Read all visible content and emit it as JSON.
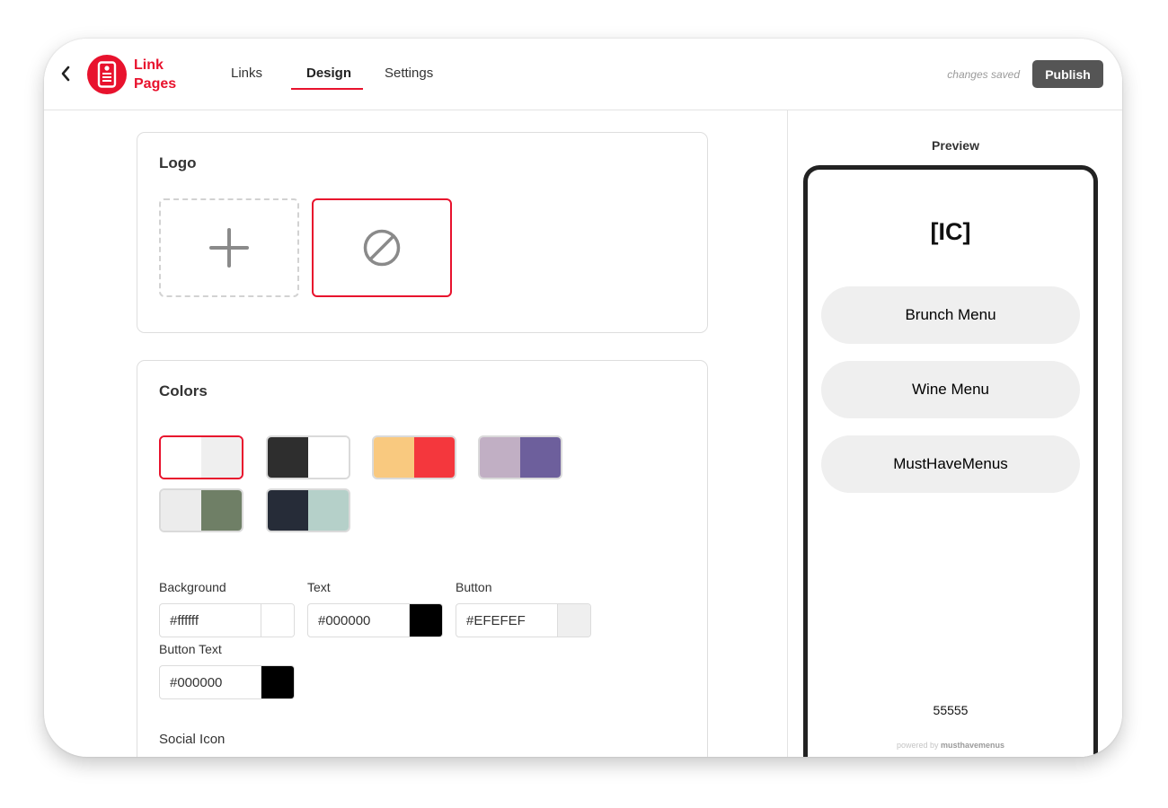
{
  "header": {
    "brand_line1": "Link",
    "brand_line2": "Pages",
    "tabs": [
      {
        "label": "Links"
      },
      {
        "label": "Design"
      },
      {
        "label": "Settings"
      }
    ],
    "active_tab": "Design",
    "status": "changes saved",
    "publish_label": "Publish"
  },
  "logo_section": {
    "title": "Logo"
  },
  "colors_section": {
    "title": "Colors",
    "presets": [
      {
        "left": "#ffffff",
        "right": "#efefef",
        "selected": true
      },
      {
        "left": "#2e2e2e",
        "right": "#ffffff",
        "selected": false
      },
      {
        "left": "#f9c97f",
        "right": "#f4373d",
        "selected": false
      },
      {
        "left": "#c1afc4",
        "right": "#6d5f9c",
        "selected": false
      },
      {
        "left": "#ececec",
        "right": "#6f7f66",
        "selected": false
      },
      {
        "left": "#262c38",
        "right": "#b5d0c9",
        "selected": false
      }
    ],
    "fields": {
      "background": {
        "label": "Background",
        "value": "#ffffff"
      },
      "text": {
        "label": "Text",
        "value": "#000000"
      },
      "button": {
        "label": "Button",
        "value": "#EFEFEF"
      },
      "button_text": {
        "label": "Button Text",
        "value": "#000000"
      }
    },
    "social_icon_label": "Social Icon"
  },
  "preview": {
    "title": "Preview",
    "logo_text": "[IC]",
    "links": [
      {
        "label": "Brunch Menu"
      },
      {
        "label": "Wine Menu"
      },
      {
        "label": "MustHaveMenus"
      }
    ],
    "footer_text": "55555",
    "powered_prefix": "powered by",
    "powered_brand": "musthavemenus"
  },
  "theme": {
    "accent": "#e8122d",
    "publish_bg": "#555555"
  },
  "icons": {
    "back": "chevron-left-icon",
    "brand": "phone-page-icon",
    "add": "plus-icon",
    "none": "no-logo-icon"
  }
}
